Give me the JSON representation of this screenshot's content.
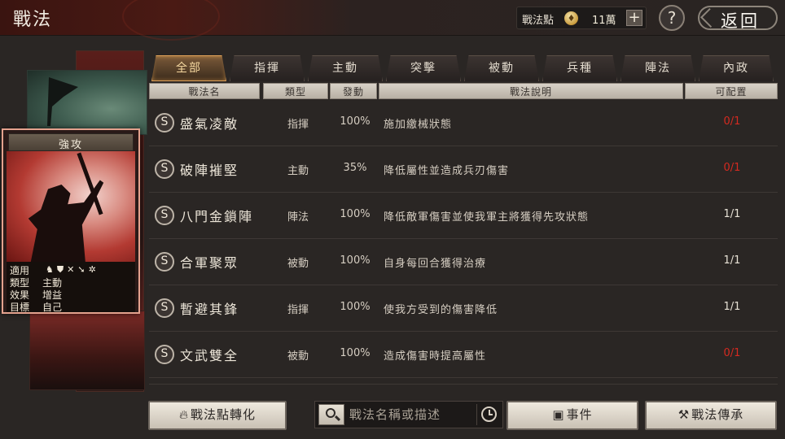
{
  "header": {
    "title": "戰法",
    "points_label": "戰法點",
    "points_value": "11萬",
    "plus_label": "+",
    "help_label": "?",
    "back_label": "返回"
  },
  "card": {
    "title": "強攻",
    "applicable_label": "適用",
    "type_label": "類型",
    "type_value": "主動",
    "effect_label": "效果",
    "effect_value": "增益",
    "target_label": "目標",
    "target_value": "自己",
    "unit_icons": [
      "cavalry-icon",
      "shield-icon",
      "bow-icon",
      "spear-icon",
      "wheel-icon"
    ]
  },
  "tabs": [
    "全部",
    "指揮",
    "主動",
    "突擊",
    "被動",
    "兵種",
    "陣法",
    "內政"
  ],
  "active_tab": 0,
  "columns": [
    "戰法名",
    "類型",
    "發動",
    "戰法說明",
    "可配置"
  ],
  "rows": [
    {
      "badge": "S",
      "name": "盛氣凌敵",
      "type": "指揮",
      "rate": "100%",
      "desc": "施加繳械狀態",
      "alloc": "0/1",
      "alloc_color": "#d42a20"
    },
    {
      "badge": "S",
      "name": "破陣摧堅",
      "type": "主動",
      "rate": "35%",
      "desc": "降低屬性並造成兵刃傷害",
      "alloc": "0/1",
      "alloc_color": "#d42a20"
    },
    {
      "badge": "S",
      "name": "八門金鎖陣",
      "type": "陣法",
      "rate": "100%",
      "desc": "降低敵軍傷害並使我軍主將獲得先攻狀態",
      "alloc": "1/1",
      "alloc_color": "#e8e2d6"
    },
    {
      "badge": "S",
      "name": "合軍聚眾",
      "type": "被動",
      "rate": "100%",
      "desc": "自身每回合獲得治療",
      "alloc": "1/1",
      "alloc_color": "#e8e2d6"
    },
    {
      "badge": "S",
      "name": "暫避其鋒",
      "type": "指揮",
      "rate": "100%",
      "desc": "使我方受到的傷害降低",
      "alloc": "1/1",
      "alloc_color": "#e8e2d6"
    },
    {
      "badge": "S",
      "name": "文武雙全",
      "type": "被動",
      "rate": "100%",
      "desc": "造成傷害時提高屬性",
      "alloc": "0/1",
      "alloc_color": "#d42a20"
    }
  ],
  "bottom": {
    "convert_label": "戰法點轉化",
    "search_placeholder": "戰法名稱或描述",
    "events_label": "事件",
    "inherit_label": "戰法傳承"
  }
}
